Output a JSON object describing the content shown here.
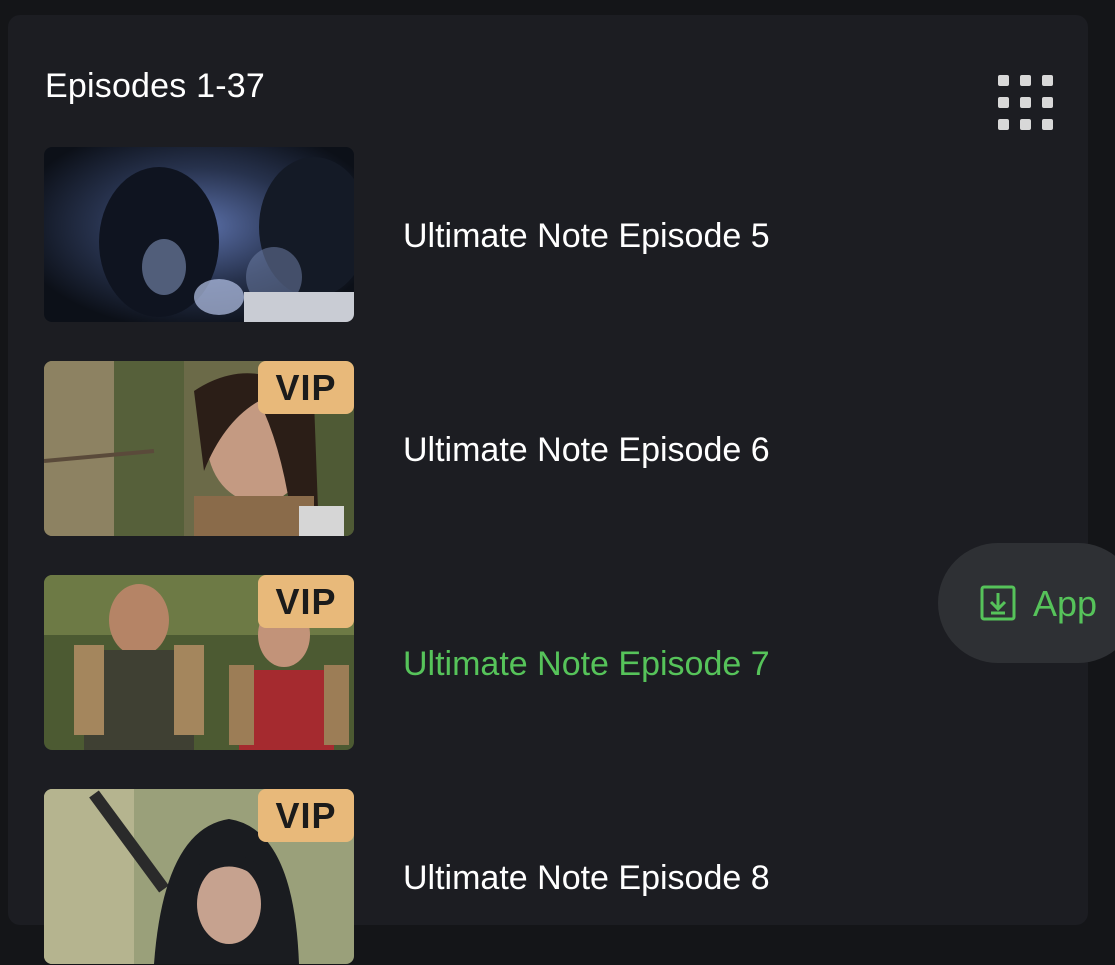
{
  "header": {
    "title": "Episodes 1-37",
    "grid_icon": "grid-view-icon"
  },
  "episodes": [
    {
      "title": "Ultimate Note Episode 5",
      "vip": false,
      "active": false,
      "badge": ""
    },
    {
      "title": "Ultimate Note Episode 6",
      "vip": true,
      "active": false,
      "badge": "VIP"
    },
    {
      "title": "Ultimate Note Episode 7",
      "vip": true,
      "active": true,
      "badge": "VIP"
    },
    {
      "title": "Ultimate Note Episode 8",
      "vip": true,
      "active": false,
      "badge": "VIP"
    }
  ],
  "app_button": {
    "label": "App",
    "icon": "download-icon"
  },
  "colors": {
    "background": "#141518",
    "panel": "#1c1d22",
    "active_green": "#56c35a",
    "vip_badge": "#e8b97a",
    "app_button_bg": "#2e3034"
  }
}
